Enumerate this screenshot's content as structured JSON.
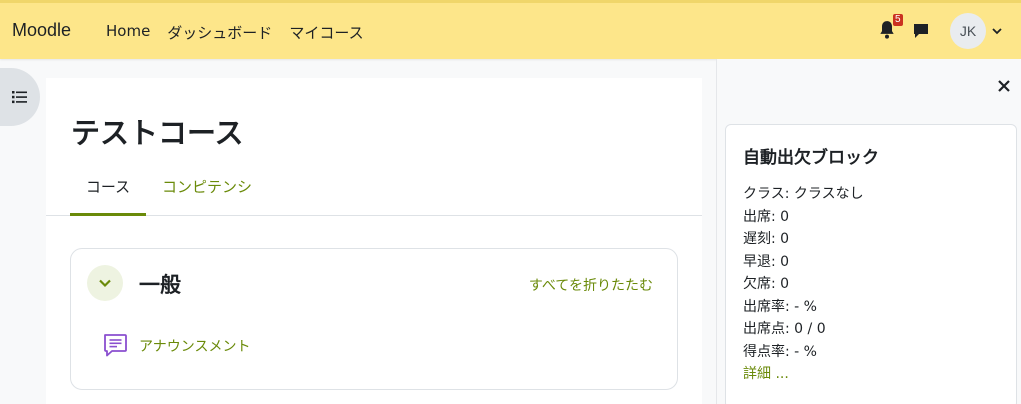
{
  "navbar": {
    "brand": "Moodle",
    "links": [
      "Home",
      "ダッシュボード",
      "マイコース"
    ],
    "notification_count": "5",
    "avatar_initials": "JK",
    "bg_color": "#fde68a"
  },
  "course": {
    "title": "テストコース",
    "tabs": [
      "コース",
      "コンピテンシ"
    ],
    "active_tab": "コース"
  },
  "section": {
    "title": "一般",
    "collapse_all": "すべてを折りたたむ",
    "activity": "アナウンスメント"
  },
  "block": {
    "title": "自動出欠ブロック",
    "lines": [
      "クラス: クラスなし",
      "出席: 0",
      "遅刻: 0",
      "早退: 0",
      "欠席: 0",
      "出席率: - %",
      "出席点: 0 / 0",
      "得点率: - %"
    ],
    "detail_link": "詳細 ..."
  },
  "colors": {
    "accent": "#6a8a09",
    "activity_icon": "#8a4fcf",
    "badge": "#ca3120"
  }
}
